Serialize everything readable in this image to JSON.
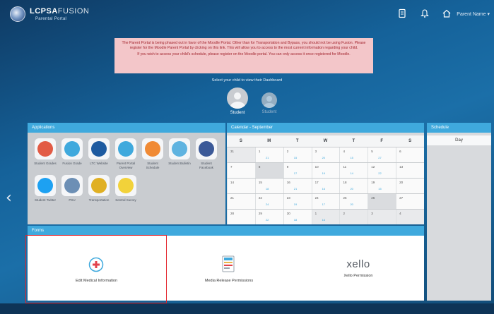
{
  "header": {
    "logo_main": "LCPSA",
    "logo_thin": "FUSION",
    "logo_sub": "Parental Portal",
    "icons": [
      "document-icon",
      "bell-icon",
      "home-icon"
    ],
    "user_menu": "Parent Name"
  },
  "notice": {
    "line1": "The Parent Portal is being phased out in favor of the Moodle Portal. Other than for Transportation and Bypass, you should not be using Fusion. Please register for the Moodle Parent Portal by clicking on this link. This will allow you to access to the most current information regarding your child.",
    "line2": "If you wish to access your child's schedule, please register on the Moodle portal. You can only access it once registered for Moodle."
  },
  "switch_label": "Select your child to view their Dashboard",
  "students": [
    {
      "name": "Student"
    },
    {
      "name": "Student"
    }
  ],
  "apps_panel": {
    "title": "Applications",
    "apps": [
      {
        "icon": "school-icon",
        "label": "Student Grades",
        "color": "#e25b45"
      },
      {
        "icon": "person-icon",
        "label": "Fusion Grade",
        "color": "#3fa9dd"
      },
      {
        "icon": "ltc-icon",
        "label": "LTC Website",
        "color": "#1d5aa0"
      },
      {
        "icon": "handshake-icon",
        "label": "Parent Portal Overview",
        "color": "#3fa9dd"
      },
      {
        "icon": "circle-icon",
        "label": "Student Schedule",
        "color": "#f08a35"
      },
      {
        "icon": "news-icon",
        "label": "Student Bulletin",
        "color": "#5fb3e0"
      },
      {
        "icon": "facebook-icon",
        "label": "Student Facebook",
        "color": "#3b5998"
      },
      {
        "icon": "twitter-icon",
        "label": "Student Twitter",
        "color": "#1da1f2"
      },
      {
        "icon": "psu-icon",
        "label": "PSU",
        "color": "#6c8fb5"
      },
      {
        "icon": "bus-icon",
        "label": "Transportation",
        "color": "#e0b023"
      },
      {
        "icon": "smiley-icon",
        "label": "Sentral Survey",
        "color": "#f2d23a"
      }
    ]
  },
  "calendar": {
    "title": "Calendar - September",
    "days": [
      "S",
      "M",
      "T",
      "W",
      "T",
      "F",
      "S"
    ],
    "weeks": [
      [
        {
          "n": "31",
          "out": true
        },
        {
          "n": "1",
          "ev": "21"
        },
        {
          "n": "2",
          "ev": "15"
        },
        {
          "n": "3",
          "ev": "20"
        },
        {
          "n": "4",
          "ev": "15"
        },
        {
          "n": "5",
          "ev": "27"
        },
        {
          "n": "6"
        }
      ],
      [
        {
          "n": "7"
        },
        {
          "n": "8",
          "today": true
        },
        {
          "n": "9",
          "ev": "17"
        },
        {
          "n": "10",
          "ev": "19"
        },
        {
          "n": "11",
          "ev": "14"
        },
        {
          "n": "12",
          "ev": "22"
        },
        {
          "n": "13"
        }
      ],
      [
        {
          "n": "14"
        },
        {
          "n": "15",
          "ev": "18"
        },
        {
          "n": "16",
          "ev": "21"
        },
        {
          "n": "17",
          "ev": "16"
        },
        {
          "n": "18",
          "ev": "20"
        },
        {
          "n": "19",
          "ev": "15"
        },
        {
          "n": "20"
        }
      ],
      [
        {
          "n": "21"
        },
        {
          "n": "22",
          "ev": "24"
        },
        {
          "n": "23",
          "ev": "19"
        },
        {
          "n": "24",
          "ev": "17"
        },
        {
          "n": "25",
          "ev": "20"
        },
        {
          "n": "26",
          "today": true
        },
        {
          "n": "27"
        }
      ],
      [
        {
          "n": "28"
        },
        {
          "n": "29",
          "ev": "22"
        },
        {
          "n": "30",
          "ev": "18"
        },
        {
          "n": "1",
          "out": true,
          "ev": "16"
        },
        {
          "n": "2",
          "out": true
        },
        {
          "n": "3",
          "out": true
        },
        {
          "n": "4",
          "out": true
        }
      ]
    ]
  },
  "schedule": {
    "title": "Schedule",
    "sub": "Day"
  },
  "forms_panel": {
    "title": "Forms",
    "items": [
      {
        "label": "Edit Medical Information",
        "icon": "medical-icon"
      },
      {
        "label": "Media Release Permissions",
        "icon": "form-icon"
      },
      {
        "brand": "xello",
        "label": "Xello Permission"
      }
    ]
  }
}
